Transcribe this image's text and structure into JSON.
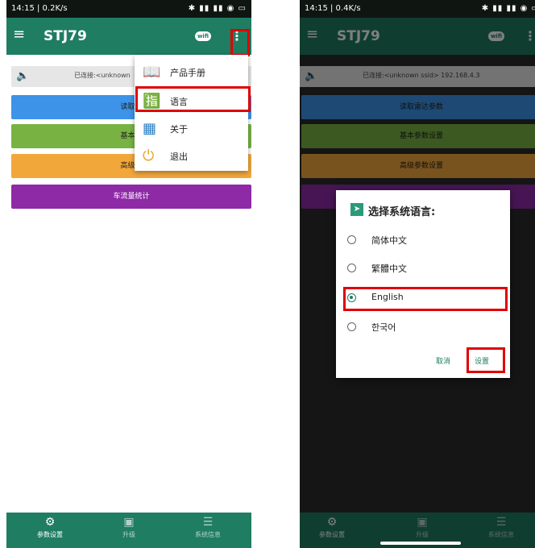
{
  "left": {
    "status": {
      "time": "14:15 | 0.2K/s",
      "icons": "✱ ▮▮ ▮▮ ◉ ▭"
    },
    "appbar": {
      "menu_icon": "hamburger-icon",
      "title": "STJ79",
      "wifi_badge": "wifi",
      "overflow_icon": "⋮"
    },
    "connection": {
      "text": "已连接:<unknown"
    },
    "buttons": [
      {
        "label": "读取雷"
      },
      {
        "label": "基本参"
      },
      {
        "label": "高级参"
      },
      {
        "label": "车流量统计"
      }
    ],
    "popup": {
      "items": [
        {
          "label": "产品手册"
        },
        {
          "label": "语言"
        },
        {
          "label": "关于"
        },
        {
          "label": "退出"
        }
      ]
    },
    "bottom_tabs": [
      {
        "label": "参数设置"
      },
      {
        "label": "升级"
      },
      {
        "label": "系统信息"
      }
    ]
  },
  "right": {
    "status": {
      "time": "14:15 | 0.4K/s",
      "icons": "✱ ▮▮ ▮▮ ◉ ▭"
    },
    "appbar": {
      "title": "STJ79"
    },
    "connection": {
      "text": "已连接:<unknown ssid> 192.168.4.3"
    },
    "buttons": [
      {
        "label": "读取雷达参数"
      },
      {
        "label": "基本参数设置"
      },
      {
        "label": "高级参数设置"
      }
    ],
    "dialog": {
      "title": "选择系统语言:",
      "options": [
        {
          "label": "简体中文",
          "selected": false
        },
        {
          "label": "繁體中文",
          "selected": false
        },
        {
          "label": "English",
          "selected": true
        },
        {
          "label": "한국어",
          "selected": false
        }
      ],
      "cancel": "取消",
      "ok": "设置"
    },
    "bottom_tabs": [
      {
        "label": "参数设置"
      },
      {
        "label": "升级"
      },
      {
        "label": "系统信息"
      }
    ]
  },
  "colors": {
    "brand": "#1f7d62",
    "highlight": "#e00000",
    "blue": "#3c93e8",
    "green": "#78b243",
    "orange": "#f2a73b",
    "purple": "#8e2aa6"
  }
}
